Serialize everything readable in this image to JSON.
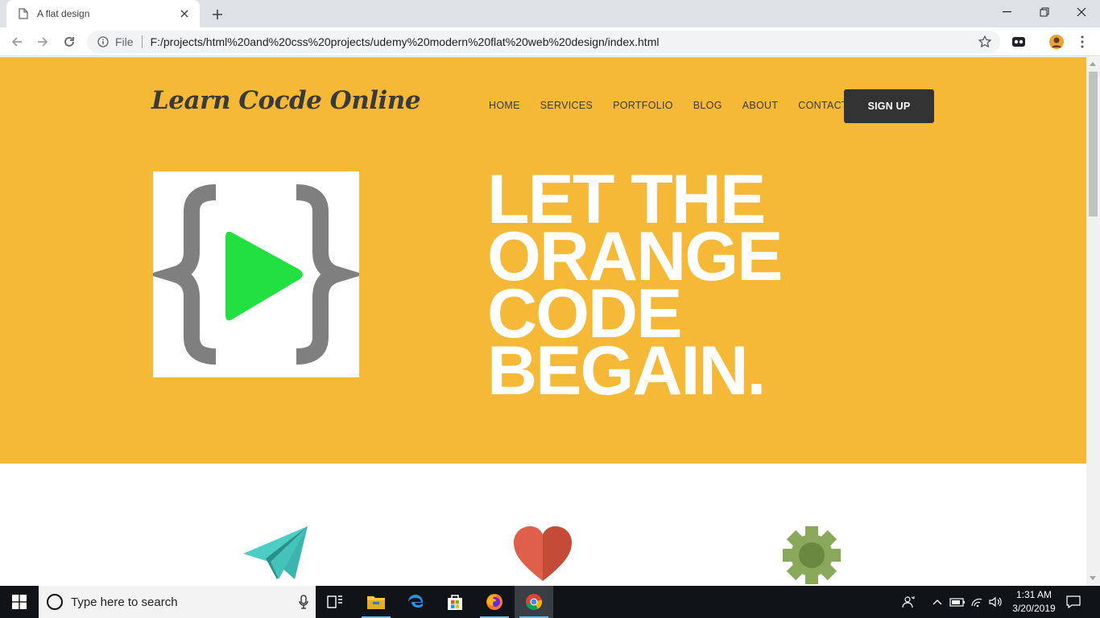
{
  "browser": {
    "tab_title": "A flat design",
    "url_scheme": "File",
    "url": "F:/projects/html%20and%20css%20projects/udemy%20modern%20flat%20web%20design/index.html"
  },
  "page": {
    "brand_color": "#f5b937",
    "logo": "Learn Cocde Online",
    "nav": [
      "HOME",
      "SERVICES",
      "PORTFOLIO",
      "BLOG",
      "ABOUT",
      "CONTACT"
    ],
    "signup_label": "SIGN UP",
    "headline_lines": [
      "LET THE",
      "ORANGE",
      "CODE",
      "BEGAIN."
    ],
    "feature_icons": [
      "paper-plane-icon",
      "heart-icon",
      "gear-icon"
    ]
  },
  "taskbar": {
    "search_placeholder": "Type here to search",
    "clock_time": "1:31 AM",
    "clock_date": "3/20/2019"
  }
}
